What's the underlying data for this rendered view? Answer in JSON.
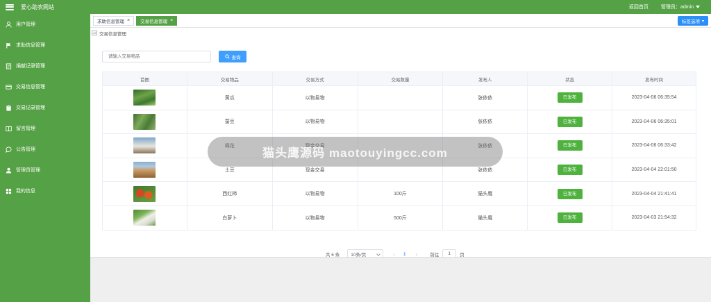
{
  "app": {
    "title": "爱心助农网站"
  },
  "header": {
    "home_link": "返回首页",
    "admin_label": "管理员：admin"
  },
  "sidebar": {
    "items": [
      {
        "label": "用户管理",
        "icon": "user-icon"
      },
      {
        "label": "求助信息管理",
        "icon": "flag-icon"
      },
      {
        "label": "捐献记录管理",
        "icon": "document-icon"
      },
      {
        "label": "交易信息管理",
        "icon": "card-icon"
      },
      {
        "label": "交易记录管理",
        "icon": "clipboard-icon"
      },
      {
        "label": "留言管理",
        "icon": "book-icon"
      },
      {
        "label": "公告管理",
        "icon": "chat-icon"
      },
      {
        "label": "管理员管理",
        "icon": "admin-icon"
      },
      {
        "label": "我的信息",
        "icon": "grid-icon"
      }
    ]
  },
  "tabs": [
    {
      "label": "求助信息管理",
      "active": false
    },
    {
      "label": "交易信息管理",
      "active": true
    }
  ],
  "tab_options_label": "标签选项",
  "breadcrumb": "交易信息管理",
  "search": {
    "placeholder": "请输入交易物品",
    "button_label": "查询"
  },
  "table": {
    "headers": [
      "首图",
      "交易物品",
      "交易方式",
      "交易数量",
      "发布人",
      "状态",
      "发布时间"
    ],
    "rows": [
      {
        "image": "cucumber-photo",
        "item": "黄瓜",
        "method": "以物易物",
        "quantity": "",
        "publisher": "张依依",
        "status": "已发布",
        "time": "2023-04-06 06:35:54"
      },
      {
        "image": "broad-bean-photo",
        "item": "蚕豆",
        "method": "以物易物",
        "quantity": "",
        "publisher": "张依依",
        "status": "已发布",
        "time": "2023-04-06 06:35:01"
      },
      {
        "image": "cotton-photo",
        "item": "棉花",
        "method": "现金交易",
        "quantity": "",
        "publisher": "张依依",
        "status": "已发布",
        "time": "2023-04-06 06:33:42"
      },
      {
        "image": "potato-photo",
        "item": "土豆",
        "method": "现金交易",
        "quantity": "",
        "publisher": "张依依",
        "status": "已发布",
        "time": "2023-04-04 22:01:50"
      },
      {
        "image": "tomato-photo",
        "item": "西红柿",
        "method": "以物易物",
        "quantity": "100斤",
        "publisher": "猫头鹰",
        "status": "已发布",
        "time": "2023-04-04 21:41:41"
      },
      {
        "image": "radish-photo",
        "item": "白萝卜",
        "method": "以物易物",
        "quantity": "500斤",
        "publisher": "猫头鹰",
        "status": "已发布",
        "time": "2023-04-03 21:54:32"
      }
    ]
  },
  "pagination": {
    "total": "共 6 条",
    "page_size": "10条/页",
    "current_page": "1",
    "goto_label": "前往",
    "goto_value": "1",
    "page_suffix": "页"
  },
  "watermark": {
    "text": "猫头鹰源码 maotouyingcc.com"
  },
  "colors": {
    "brand_green": "#55a145",
    "status_green": "#4fb23f",
    "accent_blue": "#409eff"
  }
}
